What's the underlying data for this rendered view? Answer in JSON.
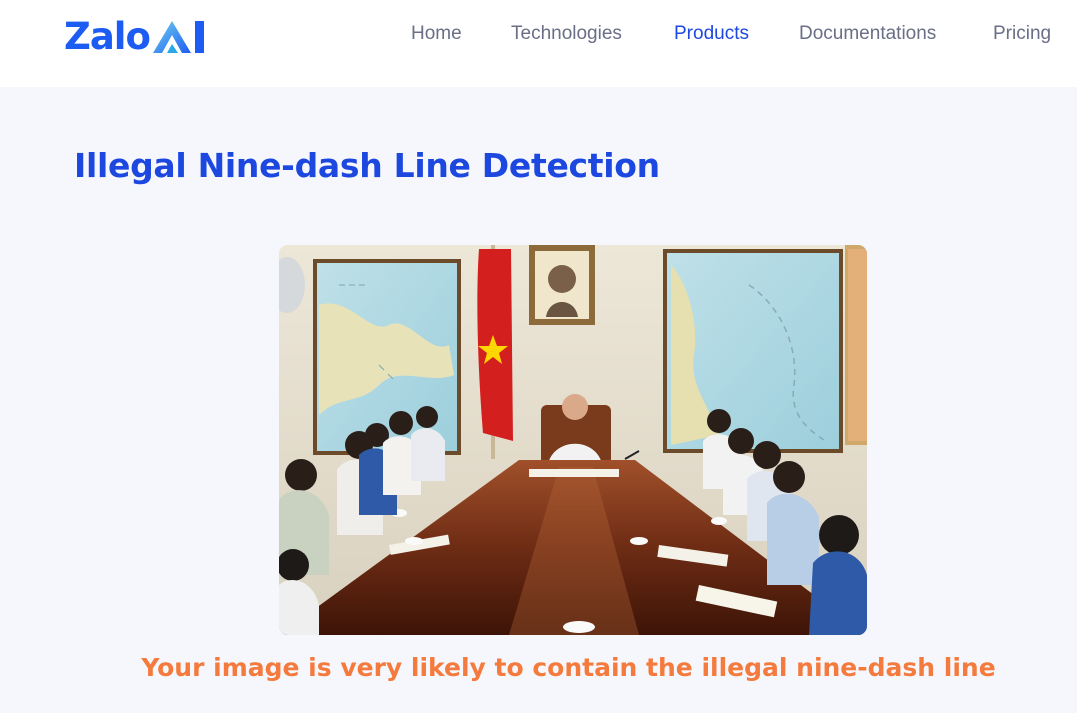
{
  "header": {
    "logo_text": "Zalo",
    "logo_mark_text": "AI",
    "nav": [
      {
        "label": "Home",
        "active": false
      },
      {
        "label": "Technologies",
        "active": false
      },
      {
        "label": "Products",
        "active": true
      },
      {
        "label": "Documentations",
        "active": false
      },
      {
        "label": "Pricing",
        "active": false
      }
    ]
  },
  "main": {
    "title": "Illegal Nine-dash Line Detection",
    "result_text": "Your image is very likely to contain the illegal nine-dash line"
  },
  "colors": {
    "brand_blue": "#1d5cf2",
    "title_blue": "#1d48e0",
    "nav_gray": "#6a6e86",
    "result_orange": "#f47a3d",
    "page_bg": "#f6f7fc"
  }
}
